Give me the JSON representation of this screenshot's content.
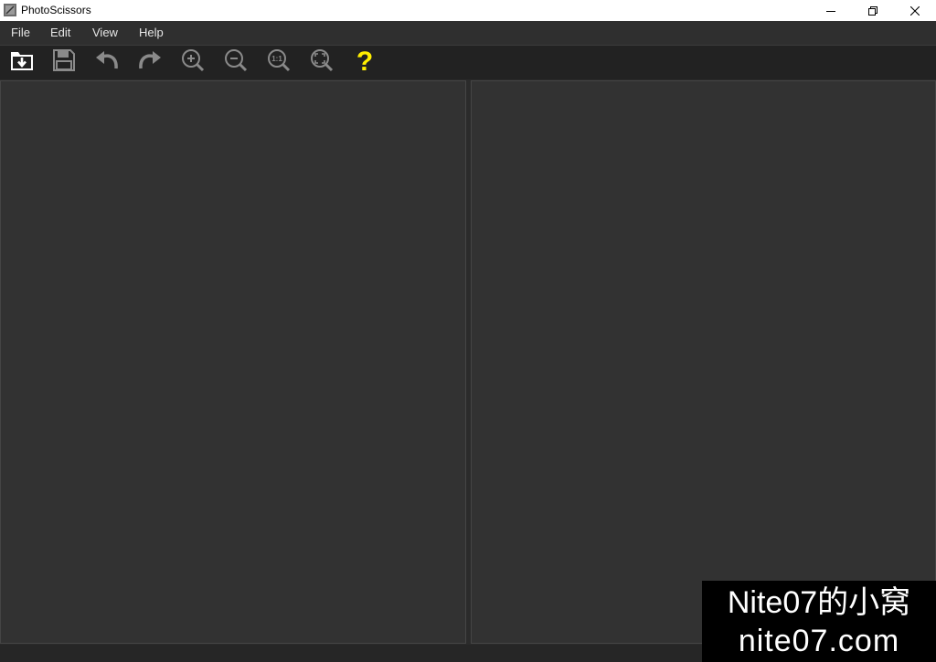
{
  "window": {
    "title": "PhotoScissors"
  },
  "menu": {
    "file": "File",
    "edit": "Edit",
    "view": "View",
    "help": "Help"
  },
  "toolbar": {
    "zoom_actual_label": "1:1",
    "help_glyph": "?",
    "icons": [
      "open-icon",
      "save-icon",
      "undo-icon",
      "redo-icon",
      "zoom-in-icon",
      "zoom-out-icon",
      "zoom-actual-icon",
      "zoom-fit-icon",
      "help-icon"
    ]
  },
  "colors": {
    "help_accent": "#ffee00",
    "panel_bg": "#323232",
    "toolbar_bg": "#222222"
  },
  "watermark": {
    "line1": "Nite07的小窝",
    "line2": "nite07.com"
  }
}
